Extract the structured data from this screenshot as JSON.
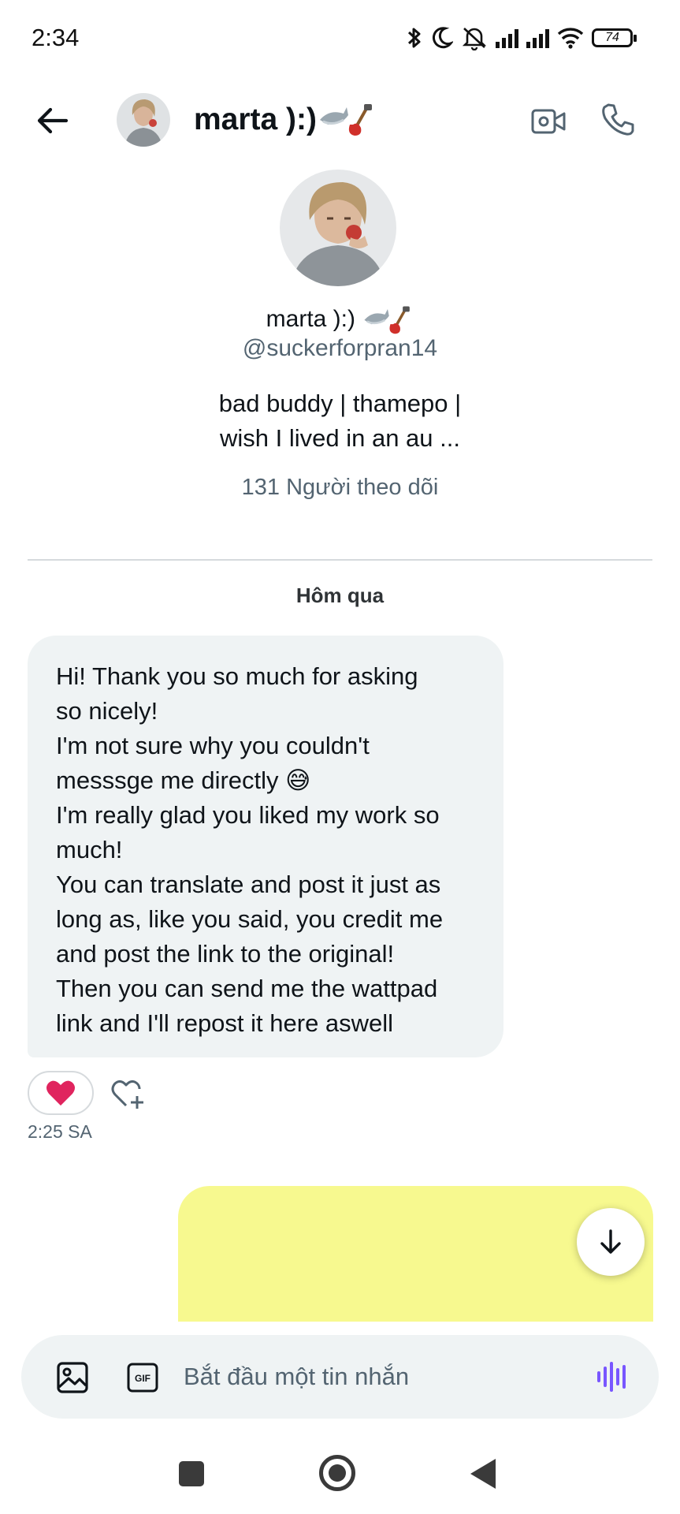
{
  "status_bar": {
    "time": "2:34",
    "battery": "74",
    "icons": [
      "bluetooth-icon",
      "moon-icon",
      "muted-bell-icon",
      "signal-icon",
      "signal-icon",
      "wifi-icon",
      "battery-icon"
    ]
  },
  "header": {
    "name": "marta ):)",
    "emoji": "🦈🎸",
    "actions": [
      "video-call-icon",
      "phone-icon"
    ]
  },
  "profile": {
    "name": "marta ):)",
    "emoji": "🦈🎸",
    "handle": "@suckerforpran14",
    "bio_lines": [
      "bad buddy | thamepo |",
      "wish I lived in an au ..."
    ],
    "followers": "131 Người theo dõi"
  },
  "conversation": {
    "date_label": "Hôm qua",
    "incoming_message": {
      "lines": [
        "Hi! Thank you so much for asking",
        "so nicely!",
        "I'm not sure why you couldn't",
        "messsge me directly 😅",
        "I'm really glad you liked my work so",
        "much!",
        "You can translate and post it just as",
        "long as, like you said, you credit me",
        "and post the link to the original!",
        "Then you can send me the wattpad",
        "link and I'll repost it here aswell"
      ],
      "reaction": "❤️",
      "time": "2:25 SA"
    }
  },
  "composer": {
    "placeholder": "Bắt đầu một tin nhắn",
    "gif_label": "GIF"
  },
  "colors": {
    "bubble_incoming": "#eff3f4",
    "bubble_outgoing_redacted": "#f7f98f",
    "secondary_text": "#536471",
    "voice_accent": "#7856ff",
    "heart": "#e0245e"
  }
}
